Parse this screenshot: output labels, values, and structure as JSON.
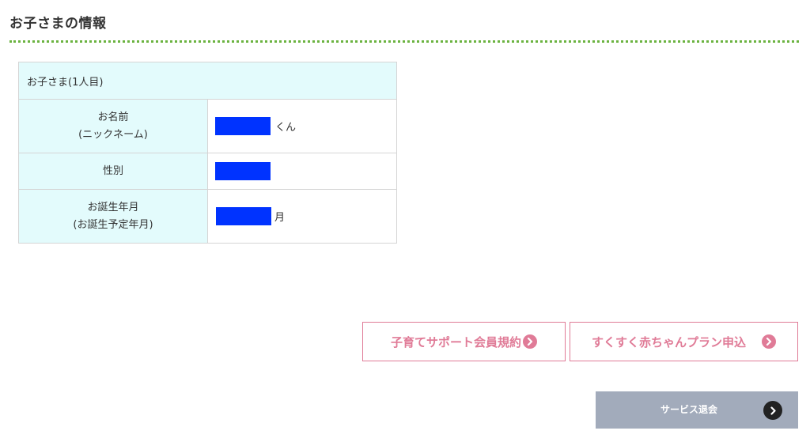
{
  "section": {
    "title": "お子さまの情報"
  },
  "child_table": {
    "caption": "お子さま(1人目)",
    "rows": [
      {
        "label_line1": "お名前",
        "label_line2": "(ニックネーム)",
        "value_suffix": "くん"
      },
      {
        "label_line1": "性別",
        "label_line2": "",
        "value_suffix": ""
      },
      {
        "label_line1": "お誕生年月",
        "label_line2": "(お誕生予定年月)",
        "value_suffix": "月"
      }
    ],
    "redaction_color": "#0033ff"
  },
  "links": {
    "terms_label": "子育てサポート会員規約",
    "plan_label": "すくすく赤ちゃんプラン申込",
    "accent_color": "#e07b97",
    "icon": "chevron-right-circle-icon"
  },
  "withdraw": {
    "label": "サービス退会",
    "background": "#a2abbb"
  }
}
